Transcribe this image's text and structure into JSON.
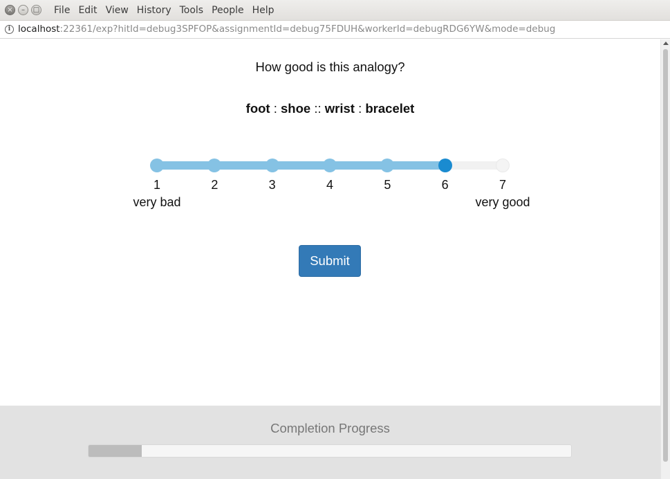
{
  "window": {
    "close_glyph": "×",
    "minimize_glyph": "–",
    "maximize_glyph": "□",
    "menu": [
      "File",
      "Edit",
      "View",
      "History",
      "Tools",
      "People",
      "Help"
    ]
  },
  "address_bar": {
    "info_glyph": "i",
    "host": "localhost",
    "rest": ":22361/exp?hitId=debug3SPFOP&assignmentId=debug75FDUH&workerId=debugRDG6YW&mode=debug"
  },
  "survey": {
    "question": "How good is this analogy?",
    "analogy": {
      "a": "foot",
      "sep1": " : ",
      "b": "shoe",
      "sep2": " :: ",
      "c": "wrist",
      "sep3": " : ",
      "d": "bracelet"
    },
    "scale": {
      "ticks": [
        "1",
        "2",
        "3",
        "4",
        "5",
        "6",
        "7"
      ],
      "selected": 6,
      "min_label": "very bad",
      "max_label": "very good"
    },
    "submit_label": "Submit"
  },
  "progress": {
    "title": "Completion Progress",
    "fraction": 0.11
  },
  "colors": {
    "accent": "#337ab7",
    "slider_fill": "#85c2e4",
    "slider_handle": "#1a8bd0"
  }
}
